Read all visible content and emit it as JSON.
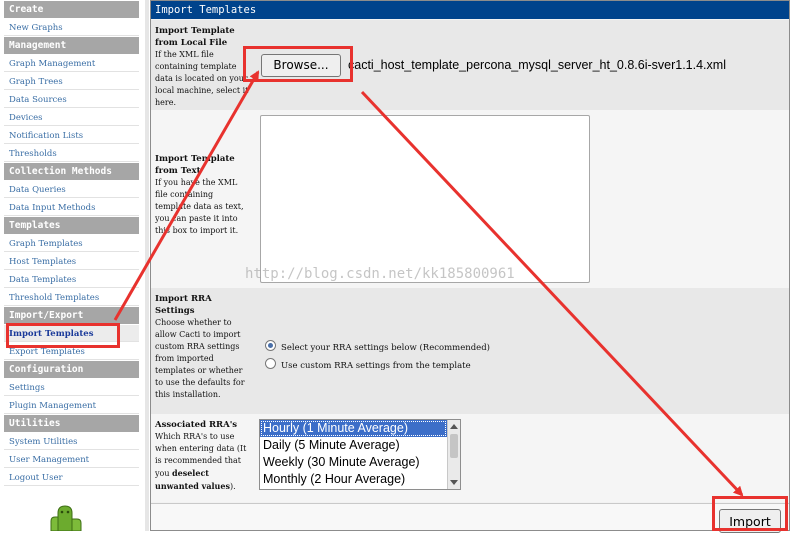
{
  "sidebar": {
    "sections": [
      {
        "title": "Create",
        "items": [
          "New Graphs"
        ]
      },
      {
        "title": "Management",
        "items": [
          "Graph Management",
          "Graph Trees",
          "Data Sources",
          "Devices",
          "Notification Lists",
          "Thresholds"
        ]
      },
      {
        "title": "Collection Methods",
        "items": [
          "Data Queries",
          "Data Input Methods"
        ]
      },
      {
        "title": "Templates",
        "items": [
          "Graph Templates",
          "Host Templates",
          "Data Templates",
          "Threshold Templates"
        ]
      },
      {
        "title": "Import/Export",
        "items": [
          "Import Templates",
          "Export Templates"
        ]
      },
      {
        "title": "Configuration",
        "items": [
          "Settings",
          "Plugin Management"
        ]
      },
      {
        "title": "Utilities",
        "items": [
          "System Utilities",
          "User Management",
          "Logout User"
        ]
      }
    ],
    "active_item": "Import Templates"
  },
  "main": {
    "title": "Import Templates",
    "local_file": {
      "label": "Import Template from Local File",
      "description": "If the XML file containing template data is located on your local machine, select it here.",
      "browse_label": "Browse...",
      "filename": "cacti_host_template_percona_mysql_server_ht_0.8.6i-sver1.1.4.xml"
    },
    "from_text": {
      "label": "Import Template from Text",
      "description": "If you have the XML file containing template data as text, you can paste it into this box to import it.",
      "value": ""
    },
    "rra_settings": {
      "label": "Import RRA Settings",
      "description": "Choose whether to allow Cacti to import custom RRA settings from imported templates or whether to use the defaults for this installation.",
      "options": [
        "Select your RRA settings below (Recommended)",
        "Use custom RRA settings from the template"
      ],
      "selected": 0
    },
    "associated_rras": {
      "label": "Associated RRA's",
      "description_start": "Which RRA's to use when entering data (It is recommended that you ",
      "description_bold": "deselect unwanted values",
      "description_end": ").",
      "options": [
        "Hourly (1 Minute Average)",
        "Daily (5 Minute Average)",
        "Weekly (30 Minute Average)",
        "Monthly (2 Hour Average)"
      ],
      "selected": 0
    },
    "import_label": "Import"
  },
  "watermark": "http://blog.csdn.net/kk185800961",
  "colors": {
    "header_blue": "#00438c",
    "section_gray": "#a6a6a6",
    "link_blue": "#3a6ea5",
    "annotation_red": "#e8322e",
    "select_highlight": "#3c6ec8"
  }
}
